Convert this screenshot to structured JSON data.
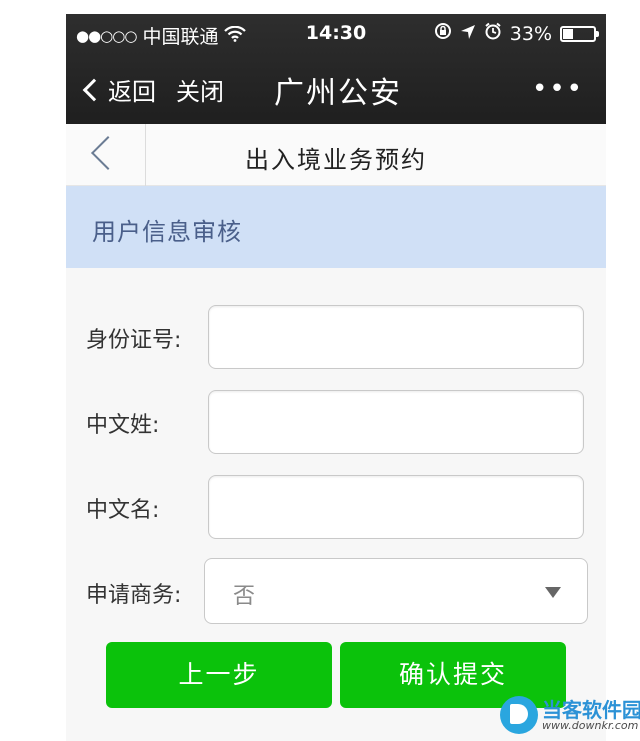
{
  "status_bar": {
    "signal": "●●○○○",
    "carrier": "中国联通",
    "wifi_icon": "wifi-icon",
    "time": "14:30",
    "battery_text": "33%",
    "battery_level": 0.33
  },
  "nav": {
    "back_label": "返回",
    "close_label": "关闭",
    "title": "广州公安",
    "more_label": "•••"
  },
  "page": {
    "title": "出入境业务预约"
  },
  "section": {
    "title": "用户信息审核"
  },
  "form": {
    "id_label": "身份证号:",
    "id_value": "",
    "surname_label": "中文姓:",
    "surname_value": "",
    "given_label": "中文名:",
    "given_value": "",
    "business_label": "申请商务:",
    "business_value": "否"
  },
  "buttons": {
    "prev": "上一步",
    "submit": "确认提交"
  },
  "watermark": {
    "name": "当客软件园",
    "url": "www.downkr.com"
  },
  "colors": {
    "accent_green": "#0bc20b",
    "section_bg": "#d0e0f6",
    "section_text": "#4a5f8a"
  }
}
